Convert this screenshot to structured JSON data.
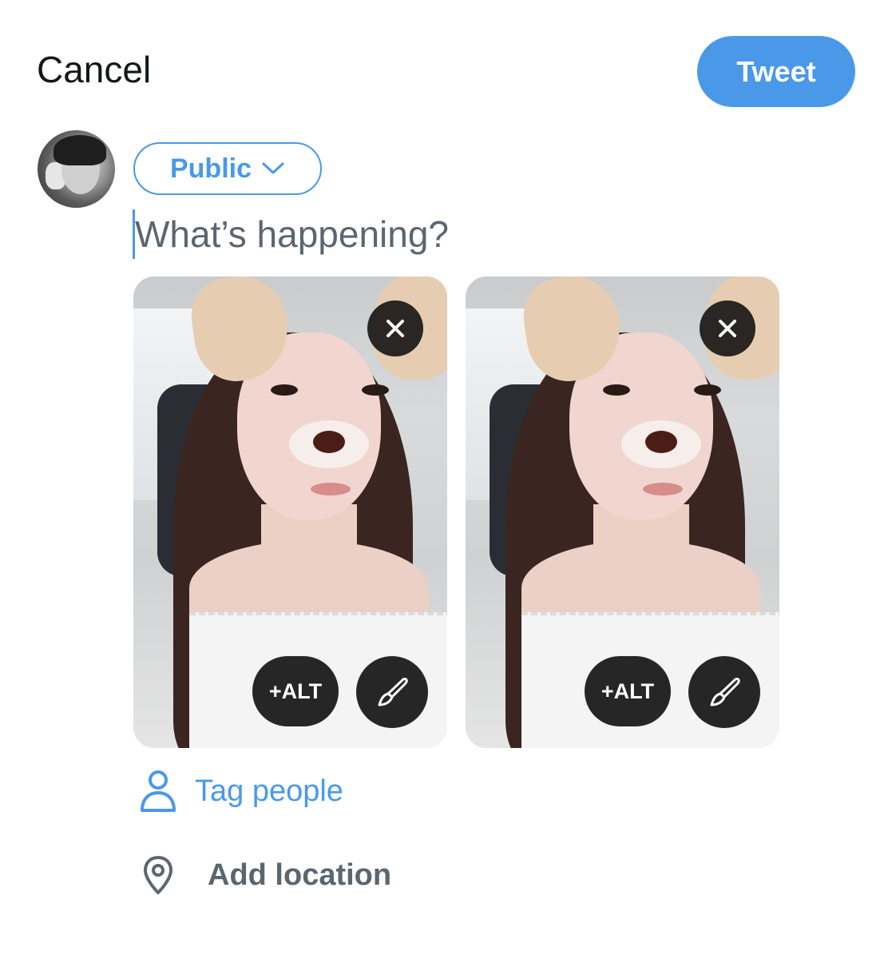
{
  "header": {
    "cancel_label": "Cancel",
    "tweet_label": "Tweet"
  },
  "audience": {
    "label": "Public"
  },
  "composer": {
    "placeholder": "What’s happening?"
  },
  "media": [
    {
      "alt_label": "+ALT"
    },
    {
      "alt_label": "+ALT"
    }
  ],
  "options": {
    "tag_people_label": "Tag people",
    "add_location_label": "Add location"
  },
  "icons": {
    "audience_caret": "chevron-down-icon",
    "remove_media": "close-icon",
    "edit_media": "brush-icon",
    "tag_people": "person-icon",
    "add_location": "location-pin-icon"
  },
  "colors": {
    "accent": "#4a99e9",
    "text_primary": "#14171a",
    "text_secondary": "#5b6670",
    "overlay_button": "#141414"
  }
}
